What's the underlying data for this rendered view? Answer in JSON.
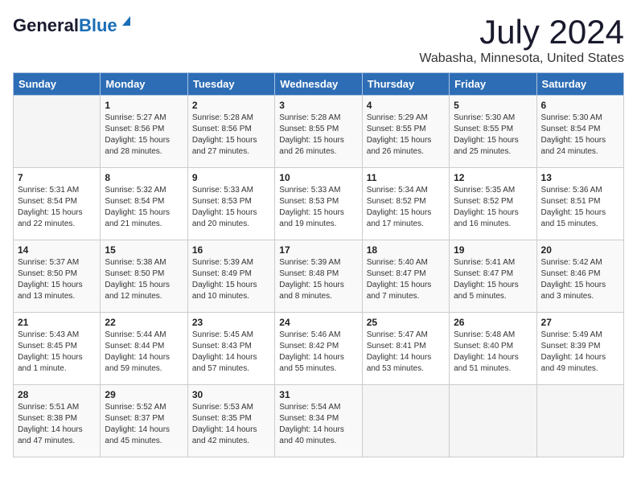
{
  "header": {
    "logo_general": "General",
    "logo_blue": "Blue",
    "month": "July 2024",
    "location": "Wabasha, Minnesota, United States"
  },
  "days_of_week": [
    "Sunday",
    "Monday",
    "Tuesday",
    "Wednesday",
    "Thursday",
    "Friday",
    "Saturday"
  ],
  "weeks": [
    [
      {
        "day": "",
        "sunrise": "",
        "sunset": "",
        "daylight": ""
      },
      {
        "day": "1",
        "sunrise": "Sunrise: 5:27 AM",
        "sunset": "Sunset: 8:56 PM",
        "daylight": "Daylight: 15 hours and 28 minutes."
      },
      {
        "day": "2",
        "sunrise": "Sunrise: 5:28 AM",
        "sunset": "Sunset: 8:56 PM",
        "daylight": "Daylight: 15 hours and 27 minutes."
      },
      {
        "day": "3",
        "sunrise": "Sunrise: 5:28 AM",
        "sunset": "Sunset: 8:55 PM",
        "daylight": "Daylight: 15 hours and 26 minutes."
      },
      {
        "day": "4",
        "sunrise": "Sunrise: 5:29 AM",
        "sunset": "Sunset: 8:55 PM",
        "daylight": "Daylight: 15 hours and 26 minutes."
      },
      {
        "day": "5",
        "sunrise": "Sunrise: 5:30 AM",
        "sunset": "Sunset: 8:55 PM",
        "daylight": "Daylight: 15 hours and 25 minutes."
      },
      {
        "day": "6",
        "sunrise": "Sunrise: 5:30 AM",
        "sunset": "Sunset: 8:54 PM",
        "daylight": "Daylight: 15 hours and 24 minutes."
      }
    ],
    [
      {
        "day": "7",
        "sunrise": "Sunrise: 5:31 AM",
        "sunset": "Sunset: 8:54 PM",
        "daylight": "Daylight: 15 hours and 22 minutes."
      },
      {
        "day": "8",
        "sunrise": "Sunrise: 5:32 AM",
        "sunset": "Sunset: 8:54 PM",
        "daylight": "Daylight: 15 hours and 21 minutes."
      },
      {
        "day": "9",
        "sunrise": "Sunrise: 5:33 AM",
        "sunset": "Sunset: 8:53 PM",
        "daylight": "Daylight: 15 hours and 20 minutes."
      },
      {
        "day": "10",
        "sunrise": "Sunrise: 5:33 AM",
        "sunset": "Sunset: 8:53 PM",
        "daylight": "Daylight: 15 hours and 19 minutes."
      },
      {
        "day": "11",
        "sunrise": "Sunrise: 5:34 AM",
        "sunset": "Sunset: 8:52 PM",
        "daylight": "Daylight: 15 hours and 17 minutes."
      },
      {
        "day": "12",
        "sunrise": "Sunrise: 5:35 AM",
        "sunset": "Sunset: 8:52 PM",
        "daylight": "Daylight: 15 hours and 16 minutes."
      },
      {
        "day": "13",
        "sunrise": "Sunrise: 5:36 AM",
        "sunset": "Sunset: 8:51 PM",
        "daylight": "Daylight: 15 hours and 15 minutes."
      }
    ],
    [
      {
        "day": "14",
        "sunrise": "Sunrise: 5:37 AM",
        "sunset": "Sunset: 8:50 PM",
        "daylight": "Daylight: 15 hours and 13 minutes."
      },
      {
        "day": "15",
        "sunrise": "Sunrise: 5:38 AM",
        "sunset": "Sunset: 8:50 PM",
        "daylight": "Daylight: 15 hours and 12 minutes."
      },
      {
        "day": "16",
        "sunrise": "Sunrise: 5:39 AM",
        "sunset": "Sunset: 8:49 PM",
        "daylight": "Daylight: 15 hours and 10 minutes."
      },
      {
        "day": "17",
        "sunrise": "Sunrise: 5:39 AM",
        "sunset": "Sunset: 8:48 PM",
        "daylight": "Daylight: 15 hours and 8 minutes."
      },
      {
        "day": "18",
        "sunrise": "Sunrise: 5:40 AM",
        "sunset": "Sunset: 8:47 PM",
        "daylight": "Daylight: 15 hours and 7 minutes."
      },
      {
        "day": "19",
        "sunrise": "Sunrise: 5:41 AM",
        "sunset": "Sunset: 8:47 PM",
        "daylight": "Daylight: 15 hours and 5 minutes."
      },
      {
        "day": "20",
        "sunrise": "Sunrise: 5:42 AM",
        "sunset": "Sunset: 8:46 PM",
        "daylight": "Daylight: 15 hours and 3 minutes."
      }
    ],
    [
      {
        "day": "21",
        "sunrise": "Sunrise: 5:43 AM",
        "sunset": "Sunset: 8:45 PM",
        "daylight": "Daylight: 15 hours and 1 minute."
      },
      {
        "day": "22",
        "sunrise": "Sunrise: 5:44 AM",
        "sunset": "Sunset: 8:44 PM",
        "daylight": "Daylight: 14 hours and 59 minutes."
      },
      {
        "day": "23",
        "sunrise": "Sunrise: 5:45 AM",
        "sunset": "Sunset: 8:43 PM",
        "daylight": "Daylight: 14 hours and 57 minutes."
      },
      {
        "day": "24",
        "sunrise": "Sunrise: 5:46 AM",
        "sunset": "Sunset: 8:42 PM",
        "daylight": "Daylight: 14 hours and 55 minutes."
      },
      {
        "day": "25",
        "sunrise": "Sunrise: 5:47 AM",
        "sunset": "Sunset: 8:41 PM",
        "daylight": "Daylight: 14 hours and 53 minutes."
      },
      {
        "day": "26",
        "sunrise": "Sunrise: 5:48 AM",
        "sunset": "Sunset: 8:40 PM",
        "daylight": "Daylight: 14 hours and 51 minutes."
      },
      {
        "day": "27",
        "sunrise": "Sunrise: 5:49 AM",
        "sunset": "Sunset: 8:39 PM",
        "daylight": "Daylight: 14 hours and 49 minutes."
      }
    ],
    [
      {
        "day": "28",
        "sunrise": "Sunrise: 5:51 AM",
        "sunset": "Sunset: 8:38 PM",
        "daylight": "Daylight: 14 hours and 47 minutes."
      },
      {
        "day": "29",
        "sunrise": "Sunrise: 5:52 AM",
        "sunset": "Sunset: 8:37 PM",
        "daylight": "Daylight: 14 hours and 45 minutes."
      },
      {
        "day": "30",
        "sunrise": "Sunrise: 5:53 AM",
        "sunset": "Sunset: 8:35 PM",
        "daylight": "Daylight: 14 hours and 42 minutes."
      },
      {
        "day": "31",
        "sunrise": "Sunrise: 5:54 AM",
        "sunset": "Sunset: 8:34 PM",
        "daylight": "Daylight: 14 hours and 40 minutes."
      },
      {
        "day": "",
        "sunrise": "",
        "sunset": "",
        "daylight": ""
      },
      {
        "day": "",
        "sunrise": "",
        "sunset": "",
        "daylight": ""
      },
      {
        "day": "",
        "sunrise": "",
        "sunset": "",
        "daylight": ""
      }
    ]
  ]
}
